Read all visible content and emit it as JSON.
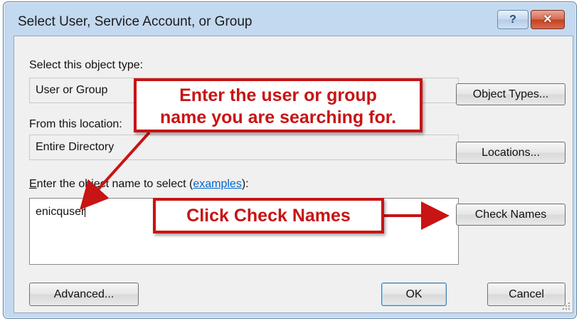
{
  "window": {
    "title": "Select User, Service Account, or Group",
    "help_glyph": "?",
    "close_glyph": "✕"
  },
  "object_type": {
    "label": "Select this object type:",
    "value": "User or Group",
    "button": "Object Types..."
  },
  "location": {
    "label": "From this location:",
    "value": "Entire Directory",
    "button": "Locations..."
  },
  "object_name": {
    "label_prefix_underlined": "E",
    "label_middle": "nter the object name to select (",
    "label_link": "examples",
    "label_suffix": "):",
    "value": "enicquser",
    "check_button": "Check Names"
  },
  "footer": {
    "advanced": "Advanced...",
    "ok": "OK",
    "cancel": "Cancel"
  },
  "annotations": {
    "callout_top_line1": "Enter the user or group",
    "callout_top_line2": "name you are searching for.",
    "callout_bottom": "Click Check Names",
    "color": "#c81414"
  },
  "icons": [
    "help-icon",
    "close-icon",
    "resize-grip-icon",
    "arrow-icon"
  ]
}
